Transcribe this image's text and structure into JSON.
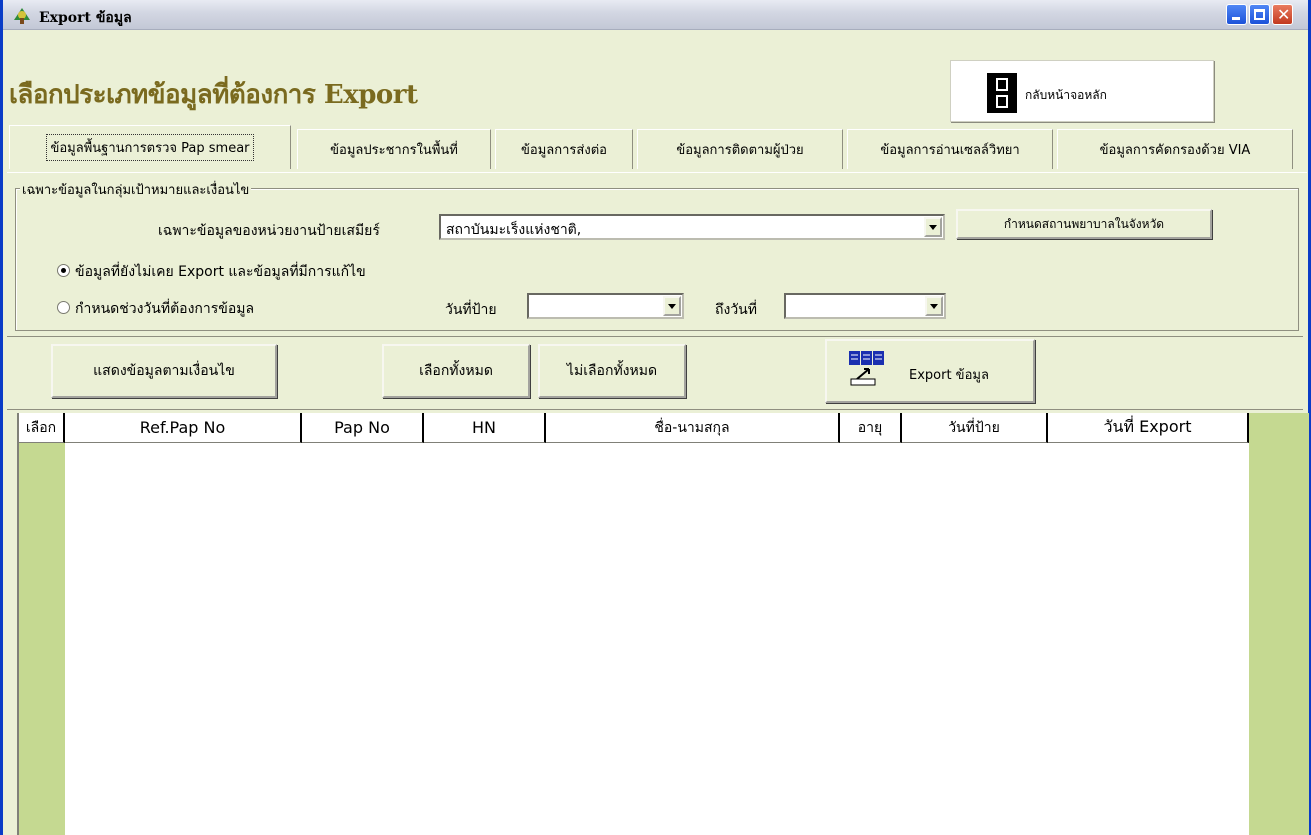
{
  "window": {
    "title": "Export ข้อมูล"
  },
  "header": {
    "title": "เลือกประเภทข้อมูลที่ต้องการ Export",
    "home_button_label": "กลับหน้าจอหลัก"
  },
  "tabs": [
    {
      "label": "ข้อมูลพื้นฐานการตรวจ Pap smear",
      "active": true
    },
    {
      "label": "ข้อมูลประชากรในพื้นที่",
      "active": false
    },
    {
      "label": "ข้อมูลการส่งต่อ",
      "active": false
    },
    {
      "label": "ข้อมูลการติดตามผู้ป่วย",
      "active": false
    },
    {
      "label": "ข้อมูลการอ่านเซลล์วิทยา",
      "active": false
    },
    {
      "label": "ข้อมูลการคัดกรองด้วย VIA",
      "active": false
    }
  ],
  "filter": {
    "group_label": "เฉพาะข้อมูลในกลุ่มเป้าหมายและเงื่อนไข",
    "unit_label": "เฉพาะข้อมูลของหน่วยงานป้ายเสมียร์",
    "unit_value": "สถาบันมะเร็งแห่งชาติ,",
    "hospital_button": "กำหนดสถานพยาบาลในจังหวัด",
    "radio_not_exported": "ข้อมูลที่ยังไม่เคย Export และข้อมูลที่มีการแก้ไข",
    "radio_date_range": "กำหนดช่วงวันที่ต้องการข้อมูล",
    "radio_selected": "not_exported",
    "date_from_label": "วันที่ป้าย",
    "date_from_value": "",
    "date_to_label": "ถึงวันที่",
    "date_to_value": ""
  },
  "actions": {
    "show_button": "แสดงข้อมูลตามเงื่อนไข",
    "select_all_button": "เลือกทั้งหมด",
    "deselect_all_button": "ไม่เลือกทั้งหมด",
    "export_button": "Export ข้อมูล"
  },
  "table": {
    "columns": [
      "เลือก",
      "Ref.Pap No",
      "Pap No",
      "HN",
      "ชื่อ-นามสกุล",
      "อายุ",
      "วันที่ป้าย",
      "วันที่ Export"
    ],
    "rows": []
  },
  "colors": {
    "background": "#ebf0d6",
    "header_title": "#7a6a1f",
    "grid_gutter": "#c5d991",
    "titlebar_border": "#0a3cc7"
  }
}
